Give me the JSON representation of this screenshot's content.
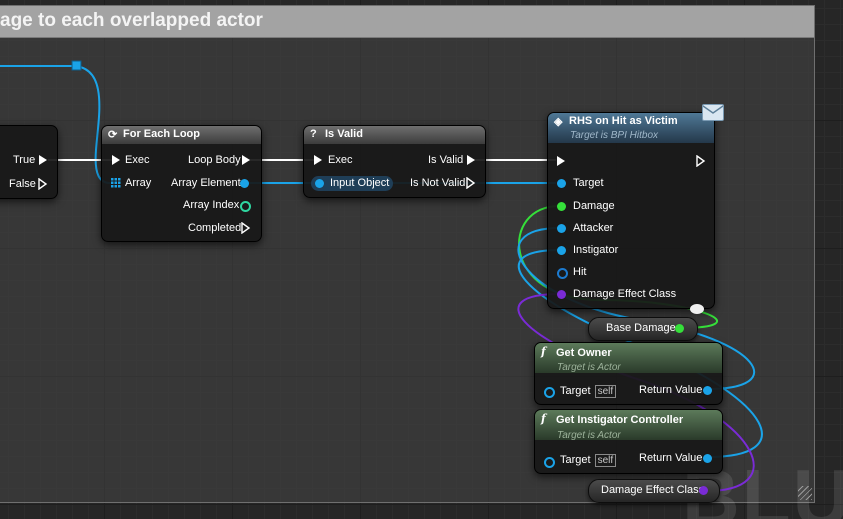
{
  "comment": {
    "title": "age to each overlapped actor"
  },
  "watermark": "BLUE",
  "branch_node": {
    "true_label": "True",
    "false_label": "False"
  },
  "for_each_node": {
    "title": "For Each Loop",
    "exec_label": "Exec",
    "array_label": "Array",
    "loop_body_label": "Loop Body",
    "array_element_label": "Array Element",
    "array_index_label": "Array Index",
    "completed_label": "Completed"
  },
  "is_valid_node": {
    "title": "Is Valid",
    "icon": "?",
    "exec_label": "Exec",
    "input_object_label": "Input Object",
    "is_valid_label": "Is Valid",
    "is_not_valid_label": "Is Not Valid"
  },
  "rhs_node": {
    "title": "RHS on Hit as Victim",
    "subtitle": "Target is BPI Hitbox",
    "pins": [
      "Target",
      "Damage",
      "Attacker",
      "Instigator",
      "Hit",
      "Damage Effect Class"
    ]
  },
  "base_damage_node": {
    "label": "Base Damage"
  },
  "get_owner_node": {
    "title": "Get Owner",
    "subtitle": "Target is Actor",
    "target_label": "Target",
    "self_label": "self",
    "return_label": "Return Value"
  },
  "get_instigator_node": {
    "title": "Get Instigator Controller",
    "subtitle": "Target is Actor",
    "target_label": "Target",
    "self_label": "self",
    "return_label": "Return Value"
  },
  "damage_effect_class_node": {
    "label": "Damage Effect Class"
  },
  "colors": {
    "exec": "#ffffff",
    "object": "#1aa3e8",
    "float": "#35e03a",
    "integer": "#2fd6a0",
    "struct": "#1c5f9e",
    "class": "#7a2bd6"
  }
}
